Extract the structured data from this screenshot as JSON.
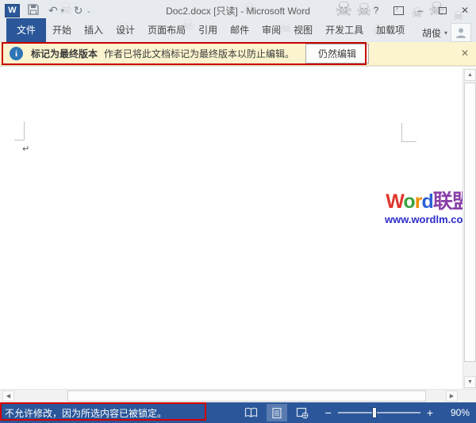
{
  "window": {
    "title": "Doc2.docx [只读] - Microsoft Word"
  },
  "titlebar": {
    "logo_letter": "W",
    "help": "?",
    "minimize": "–",
    "close": "✕"
  },
  "icons": {
    "undo": "↶",
    "redo": "↻",
    "qat_more": "⌄",
    "dropdown": "▾",
    "scroll_up": "▲",
    "scroll_down": "▼",
    "scroll_left": "◀",
    "scroll_right": "▶",
    "pilcrow": "↵",
    "skull": "☠",
    "zoom_out": "−",
    "zoom_in": "+"
  },
  "ribbon": {
    "tabs": [
      {
        "label": "文件",
        "active": true
      },
      {
        "label": "开始"
      },
      {
        "label": "插入"
      },
      {
        "label": "设计"
      },
      {
        "label": "页面布局"
      },
      {
        "label": "引用"
      },
      {
        "label": "邮件"
      },
      {
        "label": "审阅"
      },
      {
        "label": "视图"
      },
      {
        "label": "开发工具"
      },
      {
        "label": "加载项"
      }
    ],
    "user_name": "胡俊"
  },
  "notification": {
    "info_glyph": "i",
    "title": "标记为最终版本",
    "message": "作者已将此文档标记为最终版本以防止编辑。",
    "action": "仍然编辑",
    "close": "✕"
  },
  "document": {
    "watermark": {
      "letters": [
        {
          "ch": "W"
        },
        {
          "ch": "o"
        },
        {
          "ch": "r"
        },
        {
          "ch": "d"
        },
        {
          "ch": "联盟"
        }
      ],
      "url": "www.wordlm.com"
    }
  },
  "statusbar": {
    "message": "不允许修改，因为所选内容已被锁定。",
    "zoom_value": "90%"
  },
  "colors": {
    "word_blue": "#2b579a",
    "titlebar_bg": "#e7eaee",
    "notification_bg": "#fbf4cf",
    "annotation_red": "#c70000",
    "watermark_W": "#e0362c",
    "watermark_o": "#3aa33a",
    "watermark_r": "#f08c00",
    "watermark_d": "#2b5fd9",
    "watermark_lianmeng": "#8a3fa8",
    "watermark_url": "#2b2bcc",
    "statusbar_bg": "#2b579a"
  }
}
